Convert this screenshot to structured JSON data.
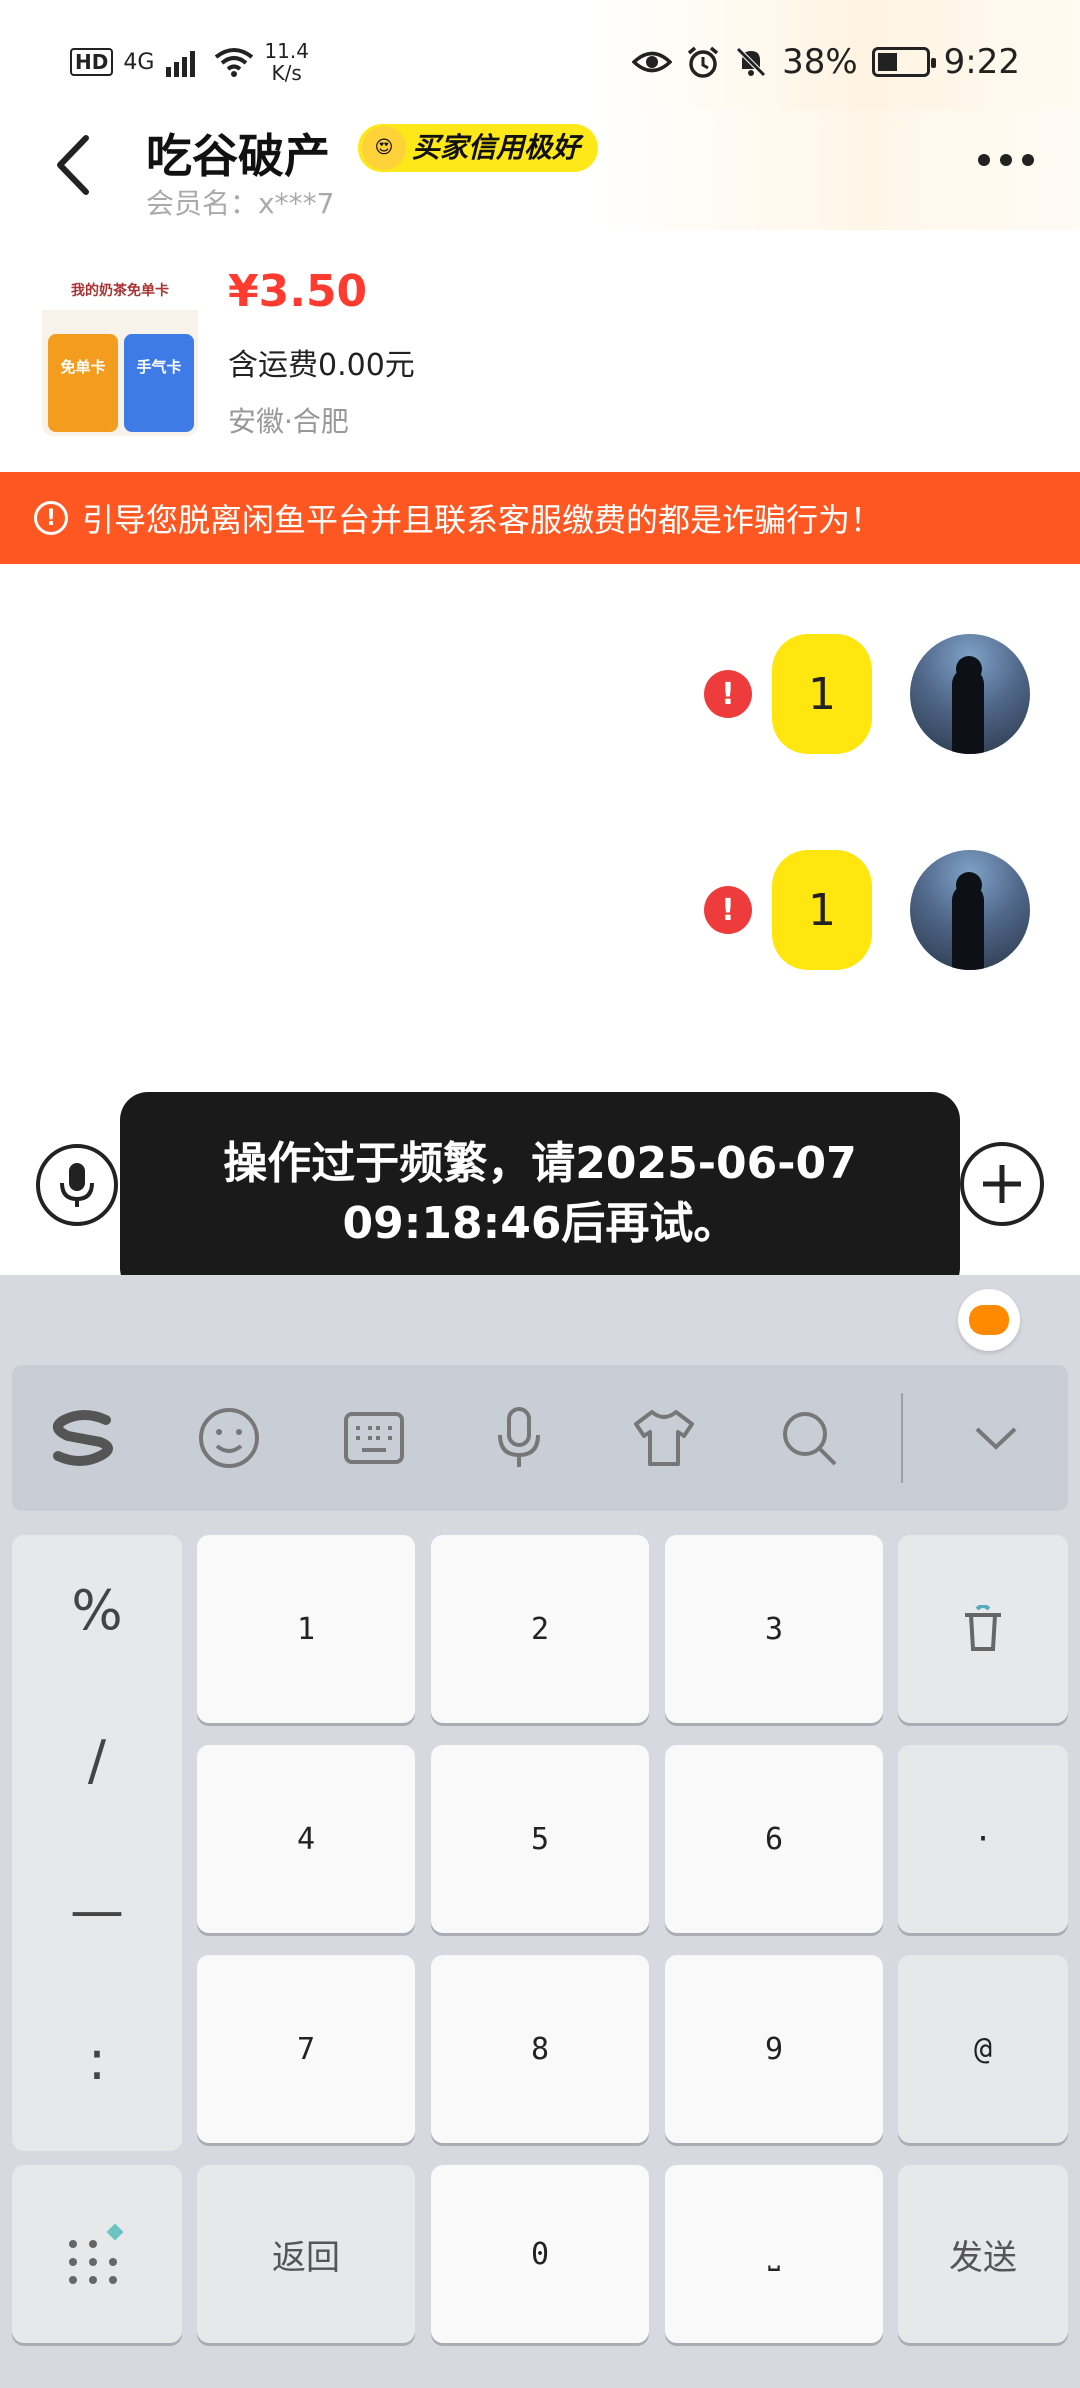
{
  "status_bar": {
    "hd": "HD",
    "network": "4G",
    "speed_value": "11.4",
    "speed_unit": "K/s",
    "battery": "38%",
    "time": "9:22"
  },
  "header": {
    "title": "吃谷破产",
    "badge": "买家信用极好",
    "subtitle": "会员名：x***7"
  },
  "product": {
    "thumb_header": "我的奶茶免单卡",
    "thumb_card1": "免单卡",
    "thumb_card2": "手气卡",
    "price": "¥3.50",
    "shipping": "含运费0.00元",
    "location": "安徽·合肥"
  },
  "warning": {
    "text": "引导您脱离闲鱼平台并且联系客服缴费的都是诈骗行为！"
  },
  "messages": [
    {
      "text": "1",
      "failed": true
    },
    {
      "text": "1",
      "failed": true
    }
  ],
  "toast": {
    "line1": "操作过于频繁，请2025-06-07",
    "line2": "09:18:46后再试。"
  },
  "keyboard": {
    "side_keys": [
      "%",
      "/",
      "—",
      ":"
    ],
    "rows": [
      [
        "1",
        "2",
        "3"
      ],
      [
        "4",
        "5",
        "6"
      ],
      [
        "7",
        "8",
        "9"
      ]
    ],
    "dot_key": "·",
    "at_key": "@",
    "back_key": "返回",
    "zero_key": "0",
    "space_key": "⎵",
    "send_key": "发送"
  },
  "colors": {
    "warning_bg": "#ff5722",
    "bubble": "#ffe60f",
    "price": "#ff3b30",
    "badge": "#ffe81a"
  }
}
